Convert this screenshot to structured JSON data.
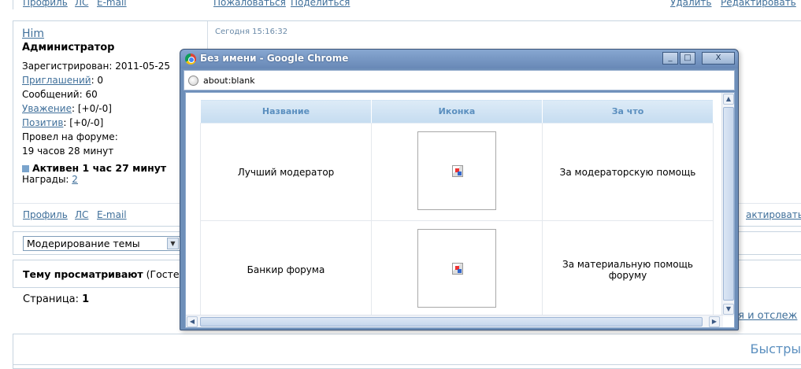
{
  "forum": {
    "top_links": {
      "profile": "Профиль",
      "pm": "ЛС",
      "email": "E-mail",
      "complain": "Пожаловаться",
      "share": "Поделиться",
      "delete": "Удалить",
      "edit": "Редактировать"
    },
    "post": {
      "author": "Him",
      "role": "Администратор",
      "date": "Сегодня 15:16:32",
      "registered_label": "Зарегистрирован:",
      "registered_value": "2011-05-25",
      "invites_label": "Приглашений",
      "invites_value": ": 0",
      "messages": "Сообщений: 60",
      "respect_label": "Уважение",
      "respect_value": ": [+0/-0]",
      "positive_label": "Позитив",
      "positive_value": ": [+0/-0]",
      "time_label": "Провел на форуме:",
      "time_value": "19 часов 28 минут",
      "active": "Активен 1 час 27 минут",
      "awards_label": "Награды:",
      "awards_value": "2"
    },
    "footer_links": {
      "profile": "Профиль",
      "pm": "ЛС",
      "email": "E-mail",
      "edit_partial": "актировать"
    },
    "moderation_select": "Модерирование темы",
    "viewing_bold": "Тему просматривают",
    "viewing_rest": " (Гостей:",
    "pages_label": "Страница:",
    "pages_current": "1",
    "track_partial": "ся и отслеж",
    "quick_partial": "Быстры"
  },
  "popup": {
    "title": "Без имени - Google Chrome",
    "minimize": "_",
    "maximize": "□",
    "close": "X",
    "address": "about:blank",
    "table": {
      "headers": [
        "Название",
        "Иконка",
        "За что"
      ],
      "rows": [
        {
          "name": "Лучший модератор",
          "reason": "За модераторскую помощь"
        },
        {
          "name": "Банкир форума",
          "reason": "За материальную помощь форуму"
        }
      ]
    }
  }
}
